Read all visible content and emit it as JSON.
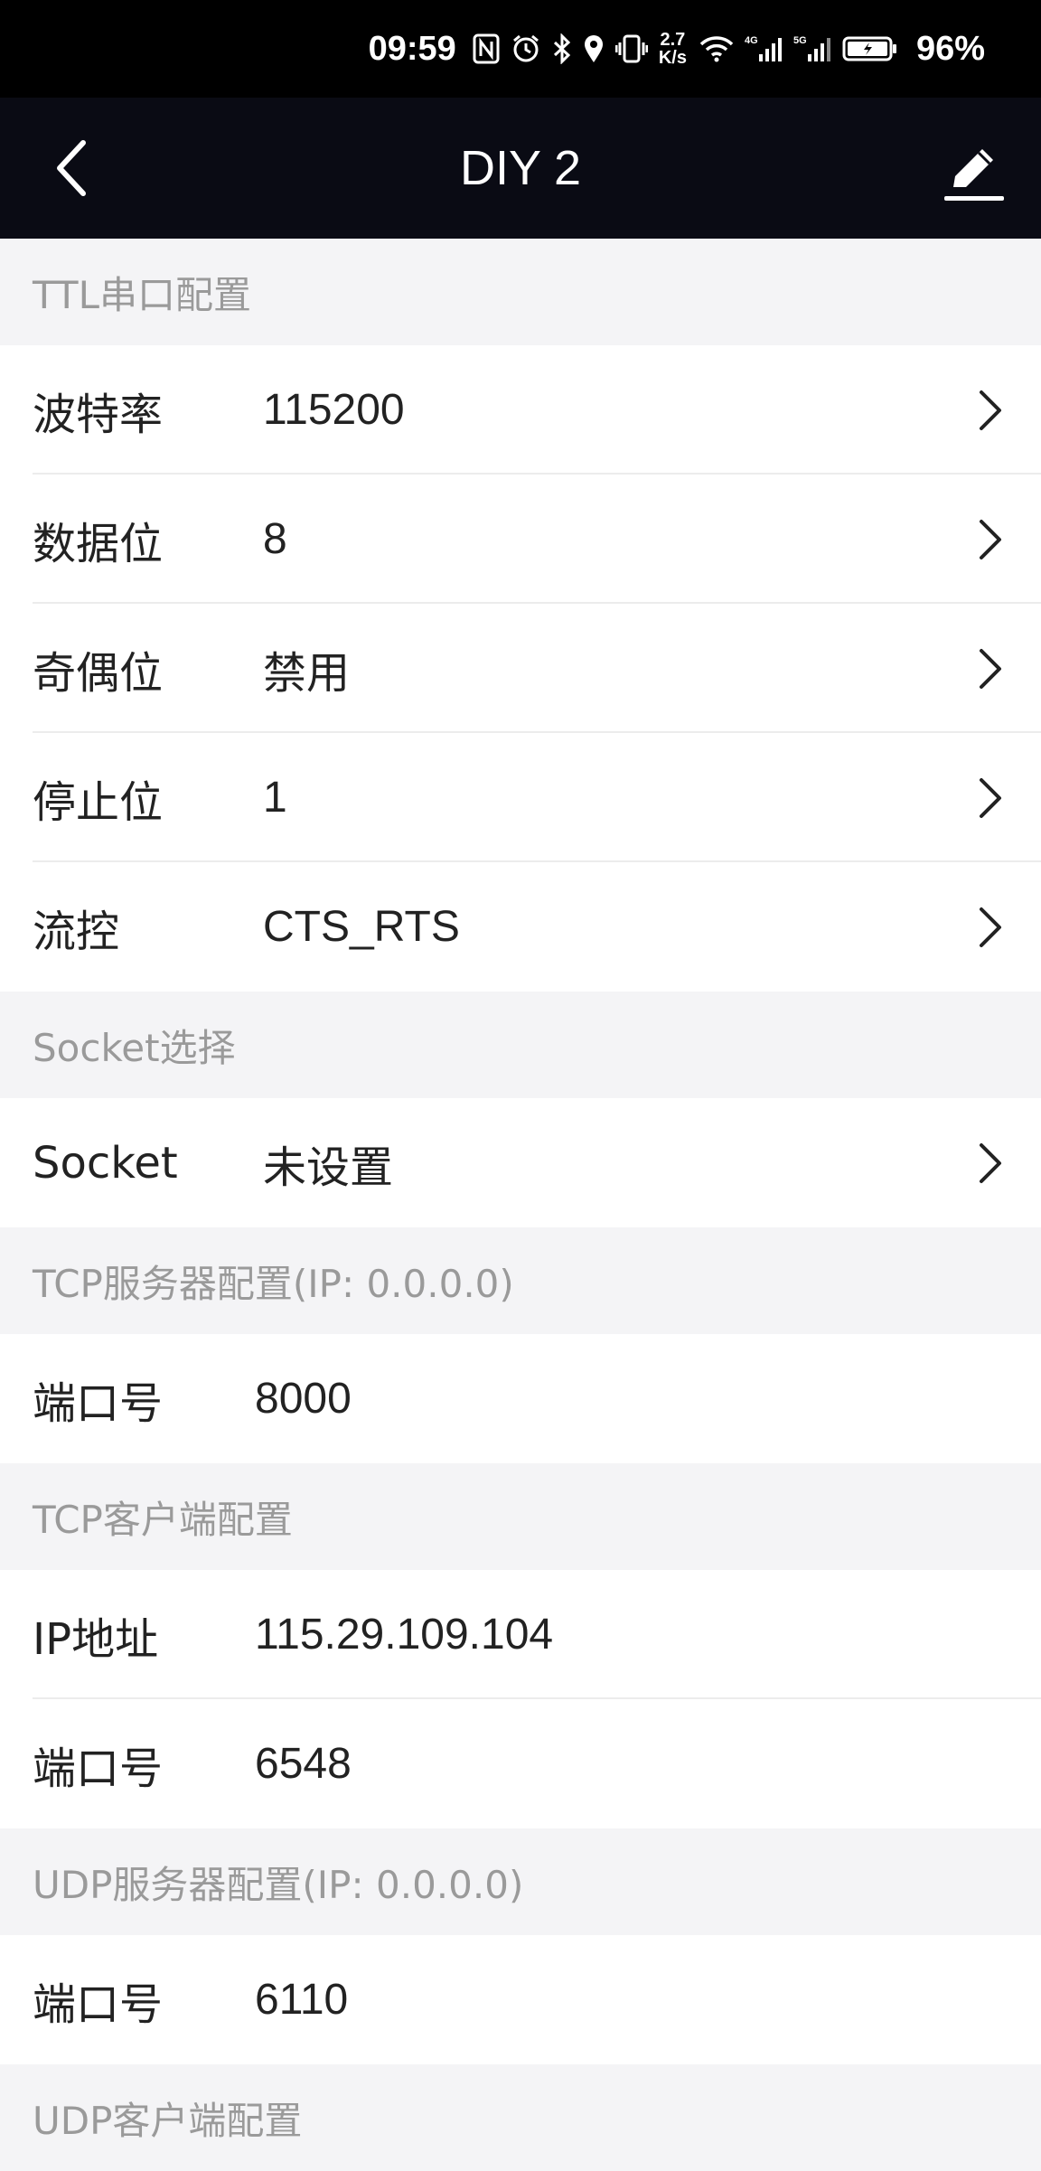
{
  "status_bar": {
    "time": "09:59",
    "net_speed_top": "2.7",
    "net_speed_bottom": "K/s",
    "battery": "96%",
    "icons": [
      "nfc-icon",
      "alarm-icon",
      "bluetooth-icon",
      "location-icon",
      "vibrate-icon",
      "wifi-icon",
      "signal-4g-icon",
      "signal-5g-icon",
      "battery-icon"
    ]
  },
  "app_bar": {
    "title": "DIY 2",
    "back_icon": "chevron-left-icon",
    "edit_icon": "pencil-icon"
  },
  "sections": {
    "ttl": {
      "header": "TTL串口配置",
      "rows": [
        {
          "label": "波特率",
          "value": "115200"
        },
        {
          "label": "数据位",
          "value": "8"
        },
        {
          "label": "奇偶位",
          "value": "禁用"
        },
        {
          "label": "停止位",
          "value": "1"
        },
        {
          "label": "流控",
          "value": "CTS_RTS"
        }
      ]
    },
    "socket": {
      "header": "Socket选择",
      "rows": [
        {
          "label": "Socket",
          "value": "未设置"
        }
      ]
    },
    "tcp_server": {
      "header": "TCP服务器配置(IP: 0.0.0.0)",
      "rows": [
        {
          "label": "端口号",
          "value": "8000"
        }
      ]
    },
    "tcp_client": {
      "header": "TCP客户端配置",
      "rows": [
        {
          "label": "IP地址",
          "value": "115.29.109.104"
        },
        {
          "label": "端口号",
          "value": "6548"
        }
      ]
    },
    "udp_server": {
      "header": "UDP服务器配置(IP: 0.0.0.0)",
      "rows": [
        {
          "label": "端口号",
          "value": "6110"
        }
      ]
    },
    "udp_client": {
      "header": "UDP客户端配置"
    }
  },
  "colors": {
    "status_bar_bg": "#000000",
    "app_bar_bg": "#0a0b14",
    "section_bg": "#f4f4f6",
    "section_text": "#9a9a9a",
    "row_text": "#222222"
  }
}
